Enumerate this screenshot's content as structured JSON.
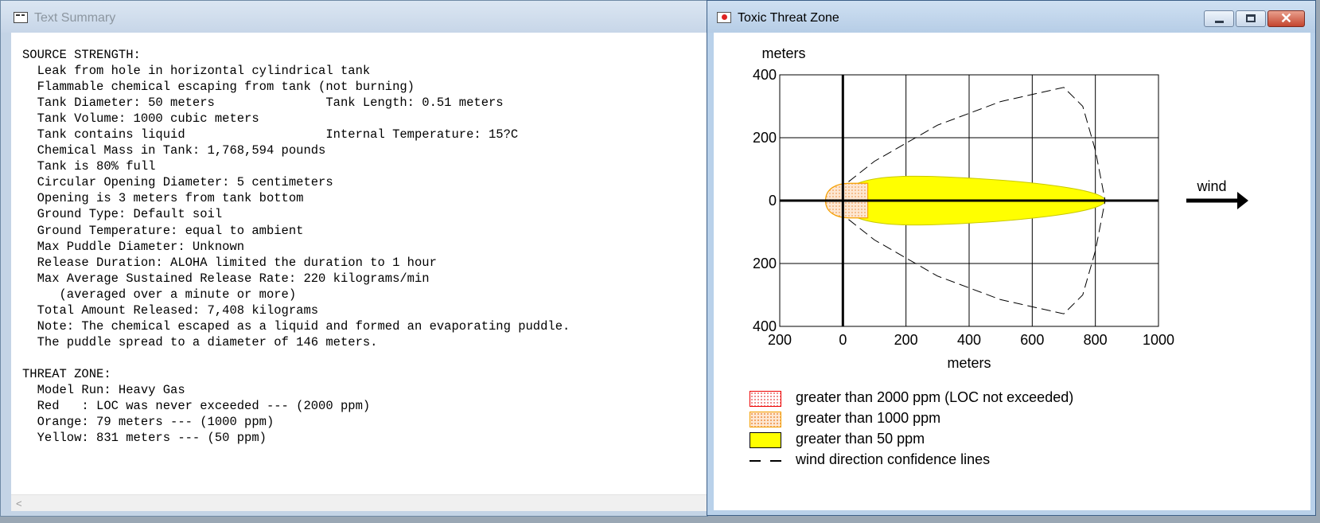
{
  "text_window": {
    "title": "Text Summary",
    "content": "SOURCE STRENGTH:\n  Leak from hole in horizontal cylindrical tank\n  Flammable chemical escaping from tank (not burning)\n  Tank Diameter: 50 meters               Tank Length: 0.51 meters\n  Tank Volume: 1000 cubic meters\n  Tank contains liquid                   Internal Temperature: 15?C\n  Chemical Mass in Tank: 1,768,594 pounds\n  Tank is 80% full\n  Circular Opening Diameter: 5 centimeters\n  Opening is 3 meters from tank bottom\n  Ground Type: Default soil\n  Ground Temperature: equal to ambient\n  Max Puddle Diameter: Unknown\n  Release Duration: ALOHA limited the duration to 1 hour\n  Max Average Sustained Release Rate: 220 kilograms/min\n     (averaged over a minute or more)\n  Total Amount Released: 7,408 kilograms\n  Note: The chemical escaped as a liquid and formed an evaporating puddle.\n  The puddle spread to a diameter of 146 meters.\n\nTHREAT ZONE:\n  Model Run: Heavy Gas\n  Red   : LOC was never exceeded --- (2000 ppm)\n  Orange: 79 meters --- (1000 ppm)\n  Yellow: 831 meters --- (50 ppm)",
    "scroll_left_glyph": "<"
  },
  "threat_window": {
    "title": "Toxic Threat Zone",
    "controls": {
      "close_glyph": "✕"
    },
    "wind_label": "wind",
    "legend": [
      {
        "key": "red",
        "text": "greater than 2000 ppm (LOC not exceeded)"
      },
      {
        "key": "orange",
        "text": "greater than 1000 ppm"
      },
      {
        "key": "yellow",
        "text": "greater than 50 ppm"
      },
      {
        "key": "dash",
        "text": "wind direction confidence lines"
      }
    ]
  },
  "colors": {
    "yellow_zone": "#ffff00",
    "orange_zone": "#f5a000",
    "red_zone": "#ee0000"
  },
  "chart_data": {
    "type": "area",
    "xlabel": "meters",
    "ylabel": "meters",
    "xlim": [
      -200,
      1000
    ],
    "ylim": [
      -400,
      400
    ],
    "x_ticks": [
      -200,
      0,
      200,
      400,
      600,
      800,
      1000
    ],
    "x_tick_labels": [
      "200",
      "0",
      "200",
      "400",
      "600",
      "800",
      "1000"
    ],
    "y_ticks": [
      400,
      200,
      0,
      -200,
      -400
    ],
    "y_tick_labels": [
      "400",
      "200",
      "0",
      "200",
      "400"
    ],
    "grid": true,
    "zones": [
      {
        "name": "greater than 50 ppm",
        "color": "#ffff00",
        "max_downwind_m": 831,
        "max_halfwidth_m": 83
      },
      {
        "name": "greater than 1000 ppm",
        "color": "#f5a000",
        "max_downwind_m": 79,
        "max_halfwidth_m": 55
      }
    ],
    "confidence_lines": {
      "upper": [
        [
          18,
          60
        ],
        [
          100,
          125
        ],
        [
          300,
          240
        ],
        [
          500,
          315
        ],
        [
          700,
          360
        ],
        [
          760,
          300
        ],
        [
          800,
          160
        ],
        [
          831,
          0
        ]
      ],
      "lower": [
        [
          18,
          -60
        ],
        [
          100,
          -125
        ],
        [
          300,
          -240
        ],
        [
          500,
          -315
        ],
        [
          700,
          -360
        ],
        [
          760,
          -300
        ],
        [
          800,
          -160
        ],
        [
          831,
          0
        ]
      ]
    }
  }
}
